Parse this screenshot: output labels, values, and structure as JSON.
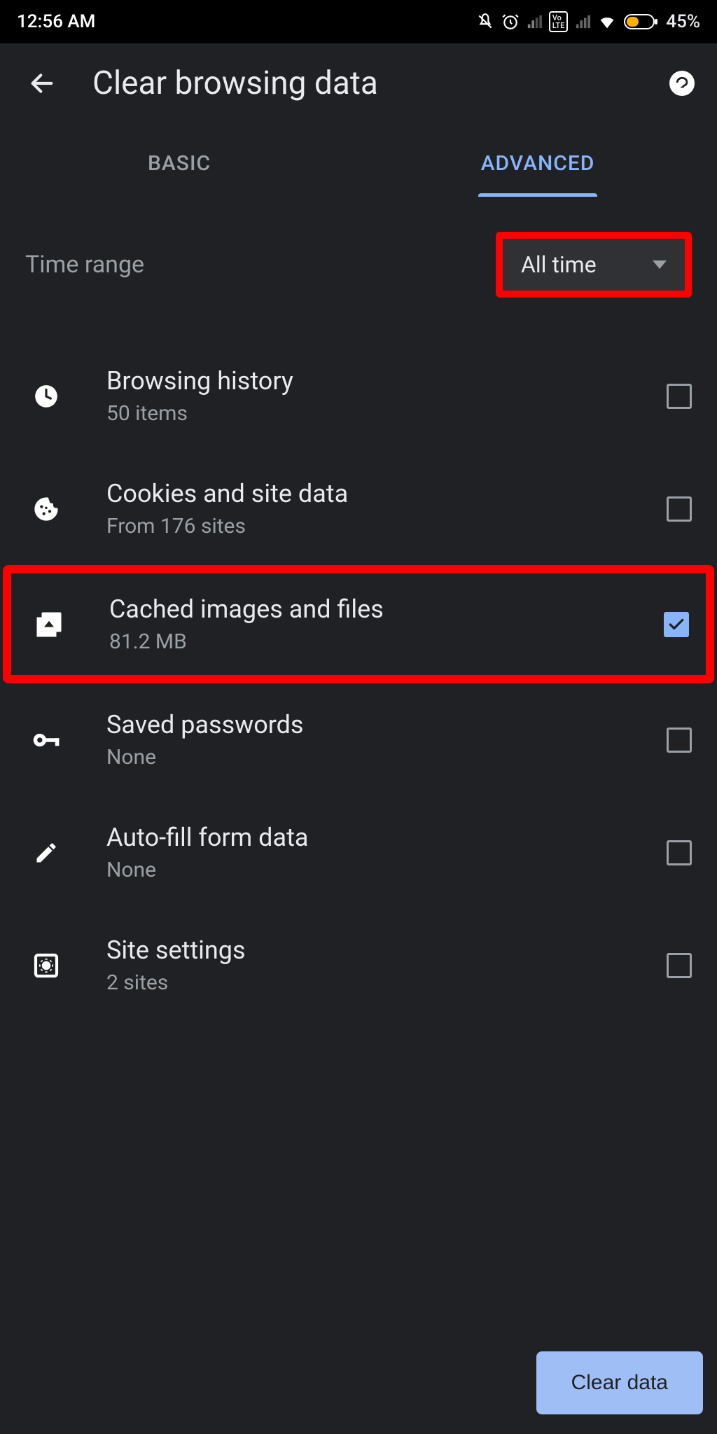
{
  "status": {
    "time": "12:56 AM",
    "battery": "45%"
  },
  "header": {
    "title": "Clear browsing data"
  },
  "tabs": {
    "basic": "BASIC",
    "advanced": "ADVANCED",
    "active": "advanced"
  },
  "time_range": {
    "label": "Time range",
    "value": "All time"
  },
  "items": [
    {
      "title": "Browsing history",
      "sub": "50 items",
      "icon": "clock-icon",
      "checked": false,
      "highlighted": false
    },
    {
      "title": "Cookies and site data",
      "sub": "From 176 sites",
      "icon": "cookie-icon",
      "checked": false,
      "highlighted": false
    },
    {
      "title": "Cached images and files",
      "sub": "81.2 MB",
      "icon": "image-icon",
      "checked": true,
      "highlighted": true
    },
    {
      "title": "Saved passwords",
      "sub": "None",
      "icon": "key-icon",
      "checked": false,
      "highlighted": false
    },
    {
      "title": "Auto-fill form data",
      "sub": "None",
      "icon": "pencil-icon",
      "checked": false,
      "highlighted": false
    },
    {
      "title": "Site settings",
      "sub": "2 sites",
      "icon": "settings-page-icon",
      "checked": false,
      "highlighted": false
    }
  ],
  "footer": {
    "clear_button": "Clear data"
  },
  "colors": {
    "accent": "#8ab4f8",
    "highlight": "#ff0000"
  }
}
